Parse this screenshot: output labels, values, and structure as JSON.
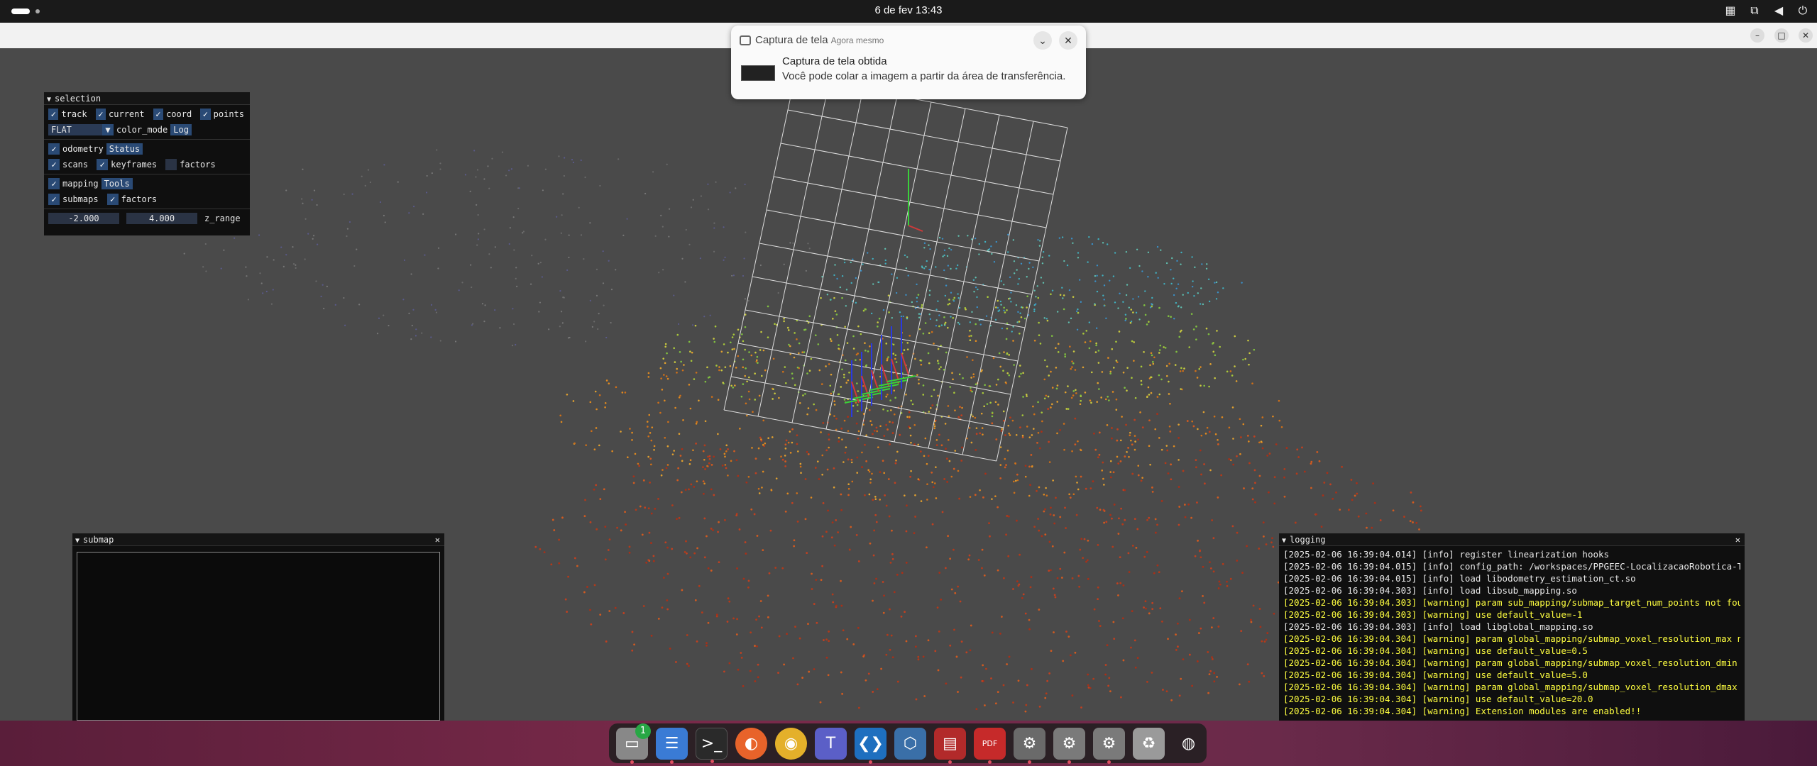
{
  "topbar": {
    "clock": "6 de fev  13:43",
    "tray_icons": [
      "grid-icon",
      "network-icon",
      "volume-icon",
      "power-icon"
    ]
  },
  "notification": {
    "app_name": "Captura de tela",
    "time": "Agora mesmo",
    "title": "Captura de tela obtida",
    "body": "Você pode colar a imagem a partir da área de transferência."
  },
  "selection_panel": {
    "title": "selection",
    "row1": [
      "track",
      "current",
      "coord",
      "points"
    ],
    "color_combo": "FLAT",
    "color_mode_label": "color_mode",
    "log_button": "Log",
    "odometry_label": "odometry",
    "status_button": "Status",
    "odo_row": [
      "scans",
      "keyframes",
      "factors"
    ],
    "mapping_label": "mapping",
    "tools_button": "Tools",
    "map_row": [
      "submaps",
      "factors"
    ],
    "z_min": "-2.000",
    "z_max": "4.000",
    "z_range_label": "z_range"
  },
  "submap_panel": {
    "title": "submap"
  },
  "logging_panel": {
    "title": "logging",
    "lines": [
      {
        "level": "info",
        "text": "[2025-02-06 16:39:04.014] [info] register linearization hooks"
      },
      {
        "level": "info",
        "text": "[2025-02-06 16:39:04.015] [info] config_path: /workspaces/PPGEEC-LocalizacaoRobotica-Trabalh"
      },
      {
        "level": "info",
        "text": "[2025-02-06 16:39:04.015] [info] load libodometry_estimation_ct.so"
      },
      {
        "level": "info",
        "text": "[2025-02-06 16:39:04.303] [info] load libsub_mapping.so"
      },
      {
        "level": "warning",
        "text": "[2025-02-06 16:39:04.303] [warning] param sub_mapping/submap_target_num_points not found"
      },
      {
        "level": "warning",
        "text": "[2025-02-06 16:39:04.303] [warning] use default_value=-1"
      },
      {
        "level": "info",
        "text": "[2025-02-06 16:39:04.303] [info] load libglobal_mapping.so"
      },
      {
        "level": "warning",
        "text": "[2025-02-06 16:39:04.304] [warning] param global_mapping/submap_voxel_resolution_max not fou"
      },
      {
        "level": "warning",
        "text": "[2025-02-06 16:39:04.304] [warning] use default_value=0.5"
      },
      {
        "level": "warning",
        "text": "[2025-02-06 16:39:04.304] [warning] param global_mapping/submap_voxel_resolution_dmin not fo"
      },
      {
        "level": "warning",
        "text": "[2025-02-06 16:39:04.304] [warning] use default_value=5.0"
      },
      {
        "level": "warning",
        "text": "[2025-02-06 16:39:04.304] [warning] param global_mapping/submap_voxel_resolution_dmax not fo"
      },
      {
        "level": "warning",
        "text": "[2025-02-06 16:39:04.304] [warning] use default_value=20.0"
      },
      {
        "level": "warning",
        "text": "[2025-02-06 16:39:04.304] [warning] Extension modules are enabled!!"
      }
    ]
  },
  "dock": {
    "files_badge": "1",
    "apps": [
      "files-icon",
      "text-editor-icon",
      "terminal-icon",
      "firefox-icon",
      "chrome-icon",
      "teams-icon",
      "vscode-icon",
      "virtualbox-icon",
      "monitor-icon",
      "pdf-icon",
      "settings-icon",
      "settings-icon",
      "settings-icon",
      "trash-icon",
      "ubuntu-icon"
    ],
    "pdf_label": "PDF"
  },
  "colors": {
    "checkbox": "#2a4a75",
    "warning": "#ffff40",
    "dock_dot": "#e05060"
  }
}
